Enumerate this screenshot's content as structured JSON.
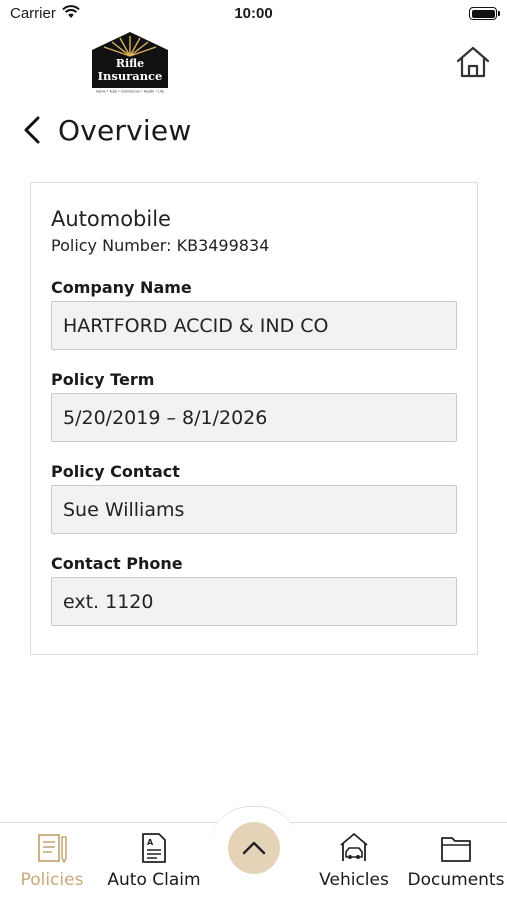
{
  "status_bar": {
    "carrier": "Carrier",
    "time": "10:00"
  },
  "header": {
    "logo": {
      "line1": "Rifle",
      "line2": "Insurance",
      "tagline": "Home • Auto • Commercial • Health • Life"
    },
    "title": "Overview"
  },
  "policy": {
    "type": "Automobile",
    "number_label": "Policy Number:",
    "number": "KB3499834",
    "fields": [
      {
        "label": "Company Name",
        "value": "HARTFORD ACCID & IND CO"
      },
      {
        "label": "Policy Term",
        "value": "5/20/2019 – 8/1/2026"
      },
      {
        "label": "Policy Contact",
        "value": "Sue Williams"
      },
      {
        "label": "Contact Phone",
        "value": "ext. 1120"
      }
    ]
  },
  "tabs": [
    {
      "label": "Policies",
      "icon": "policies-icon",
      "active": true
    },
    {
      "label": "Auto Claim",
      "icon": "auto-claim-icon",
      "active": false
    },
    {
      "label": "Vehicles",
      "icon": "vehicles-icon",
      "active": false
    },
    {
      "label": "Documents",
      "icon": "documents-icon",
      "active": false
    }
  ],
  "colors": {
    "accent": "#c8a97a",
    "center_button": "#e4d3b7",
    "field_bg": "#f2f2f2",
    "logo_bg": "#111111",
    "logo_sun": "#d8b15a"
  }
}
